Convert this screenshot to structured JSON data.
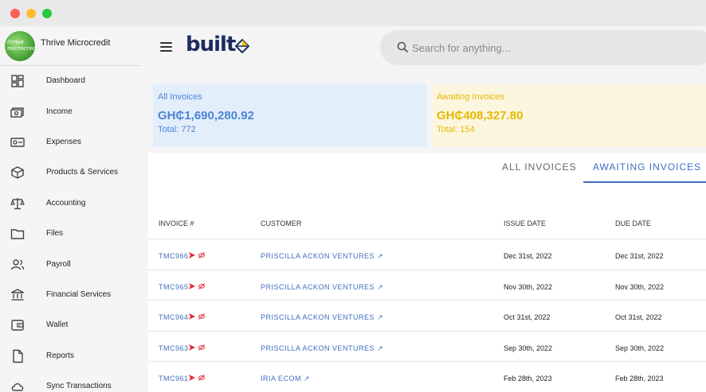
{
  "organization": {
    "name": "Thrive Microcredit",
    "logo_text": "thrive microcredit"
  },
  "sidebar": {
    "items": [
      {
        "label": "Dashboard",
        "icon": "dashboard-icon"
      },
      {
        "label": "Income",
        "icon": "income-icon"
      },
      {
        "label": "Expenses",
        "icon": "expenses-icon"
      },
      {
        "label": "Products & Services",
        "icon": "box-icon"
      },
      {
        "label": "Accounting",
        "icon": "scale-icon"
      },
      {
        "label": "Files",
        "icon": "folder-icon"
      },
      {
        "label": "Payroll",
        "icon": "people-icon"
      },
      {
        "label": "Financial Services",
        "icon": "bank-icon"
      },
      {
        "label": "Wallet",
        "icon": "wallet-icon"
      },
      {
        "label": "Reports",
        "icon": "document-icon"
      },
      {
        "label": "Sync Transactions",
        "icon": "cloud-sync-icon"
      }
    ]
  },
  "header": {
    "brand": "built",
    "search_placeholder": "Search for anything..."
  },
  "summary": {
    "all": {
      "title": "All Invoices",
      "amount": "GH₵1,690,280.92",
      "total": "Total: 772",
      "color": "#4a84d4"
    },
    "awaiting": {
      "title": "Awaiting Invoices",
      "amount": "GH₵408,327.80",
      "total": "Total: 154",
      "color": "#e6b800"
    }
  },
  "tabs": [
    {
      "label": "ALL INVOICES",
      "active": false
    },
    {
      "label": "AWAITING INVOICES",
      "active": true
    }
  ],
  "table": {
    "headers": {
      "invoice": "INVOICE #",
      "customer": "CUSTOMER",
      "issue_date": "ISSUE DATE",
      "due_date": "DUE DATE"
    },
    "rows": [
      {
        "invoice": "TMC966",
        "customer": "PRISCILLA ACKON VENTURES",
        "issue_date": "Dec 31st, 2022",
        "due_date": "Dec 31st, 2022"
      },
      {
        "invoice": "TMC965",
        "customer": "PRISCILLA ACKON VENTURES",
        "issue_date": "Nov 30th, 2022",
        "due_date": "Nov 30th, 2022"
      },
      {
        "invoice": "TMC964",
        "customer": "PRISCILLA ACKON VENTURES",
        "issue_date": "Oct 31st, 2022",
        "due_date": "Oct 31st, 2022"
      },
      {
        "invoice": "TMC963",
        "customer": "PRISCILLA ACKON VENTURES",
        "issue_date": "Sep 30th, 2022",
        "due_date": "Sep 30th, 2022"
      },
      {
        "invoice": "TMC961",
        "customer": "IRIA ECOM",
        "issue_date": "Feb 28th, 2023",
        "due_date": "Feb 28th, 2023"
      }
    ]
  },
  "colors": {
    "accent": "#3f6fc1",
    "brand_navy": "#1c2c60",
    "send_red": "#e0282e"
  }
}
